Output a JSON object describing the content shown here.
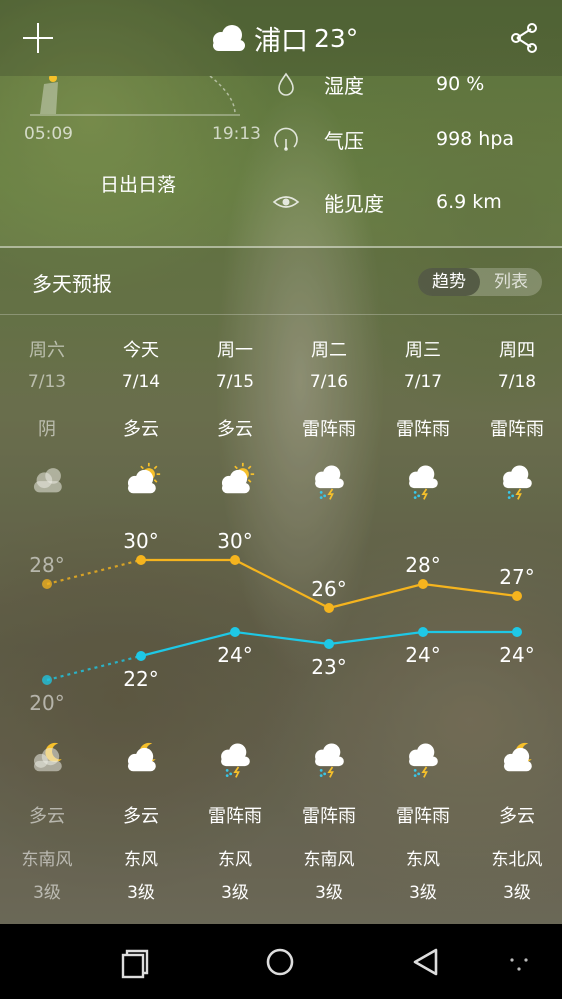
{
  "header": {
    "city": "浦口",
    "temp": "23°",
    "weather_icon": "cloud-icon",
    "add_icon": "plus-icon",
    "share_icon": "share-icon"
  },
  "sun": {
    "sunrise": "05:09",
    "sunset": "19:13",
    "label": "日出日落"
  },
  "details": [
    {
      "icon": "droplet-icon",
      "label": "湿度",
      "value": "90 %"
    },
    {
      "icon": "gauge-icon",
      "label": "气压",
      "value": "998 hpa"
    },
    {
      "icon": "eye-icon",
      "label": "能见度",
      "value": "6.9 km"
    }
  ],
  "forecast": {
    "title": "多天预报",
    "toggle": {
      "active": "趋势",
      "inactive": "列表"
    },
    "days": [
      {
        "day": "周六",
        "date": "7/13",
        "cond_day": "阴",
        "icon_day": "overcast-icon",
        "high": "28°",
        "low": "20°",
        "cond_night": "多云",
        "icon_night": "cloudy-night-icon",
        "wind": "东南风",
        "level": "3级",
        "past": true
      },
      {
        "day": "今天",
        "date": "7/14",
        "cond_day": "多云",
        "icon_day": "partly-sunny-icon",
        "high": "30°",
        "low": "22°",
        "cond_night": "多云",
        "icon_night": "cloudy-night-icon",
        "wind": "东风",
        "level": "3级",
        "past": false
      },
      {
        "day": "周一",
        "date": "7/15",
        "cond_day": "多云",
        "icon_day": "partly-sunny-icon",
        "high": "30°",
        "low": "24°",
        "cond_night": "雷阵雨",
        "icon_night": "thunderstorm-icon",
        "wind": "东风",
        "level": "3级",
        "past": false
      },
      {
        "day": "周二",
        "date": "7/16",
        "cond_day": "雷阵雨",
        "icon_day": "thunderstorm-icon",
        "high": "26°",
        "low": "23°",
        "cond_night": "雷阵雨",
        "icon_night": "thunderstorm-icon",
        "wind": "东南风",
        "level": "3级",
        "past": false
      },
      {
        "day": "周三",
        "date": "7/17",
        "cond_day": "雷阵雨",
        "icon_day": "thunderstorm-icon",
        "high": "28°",
        "low": "24°",
        "cond_night": "雷阵雨",
        "icon_night": "thunderstorm-icon",
        "wind": "东风",
        "level": "3级",
        "past": false
      },
      {
        "day": "周四",
        "date": "7/18",
        "cond_day": "雷阵雨",
        "icon_day": "thunderstorm-icon",
        "high": "27°",
        "low": "24°",
        "cond_night": "多云",
        "icon_night": "cloudy-night-icon",
        "wind": "东北风",
        "level": "3级",
        "past": false
      }
    ]
  },
  "chart_data": {
    "type": "line",
    "x": [
      "7/13",
      "7/14",
      "7/15",
      "7/16",
      "7/17",
      "7/18"
    ],
    "series": [
      {
        "values": [
          28,
          30,
          30,
          26,
          28,
          27
        ],
        "color": "#f5b41e"
      },
      {
        "values": [
          20,
          22,
          24,
          23,
          24,
          24
        ],
        "color": "#1ec8e6"
      }
    ],
    "ylim": [
      20,
      30
    ],
    "grid": false
  },
  "navbar": {
    "back_icon": "back-triangle-icon",
    "home_icon": "home-circle-icon",
    "recent_icon": "recent-apps-icon",
    "menu_icon": "menu-dots-icon"
  },
  "colors": {
    "high_line": "#f5b41e",
    "low_line": "#1ec8e6",
    "navbar": "#000000"
  }
}
